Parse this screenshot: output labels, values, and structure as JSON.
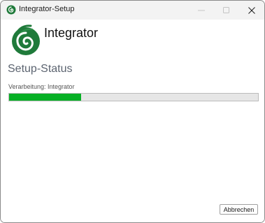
{
  "window": {
    "title": "Integrator-Setup",
    "controls": {
      "minimize": "minimize-icon",
      "maximize": "maximize-icon",
      "close": "close-icon"
    }
  },
  "header": {
    "product_name": "Integrator",
    "logo_icon": "swirl-logo-icon"
  },
  "main": {
    "section_title": "Setup-Status",
    "status_text": "Verarbeitung: Integrator",
    "progress_fraction": 0.29
  },
  "footer": {
    "cancel_label": "Abbrechen"
  },
  "colors": {
    "progress_fill": "#06b025",
    "logo_green": "#1f7a3a",
    "section_title": "#5c6470"
  }
}
